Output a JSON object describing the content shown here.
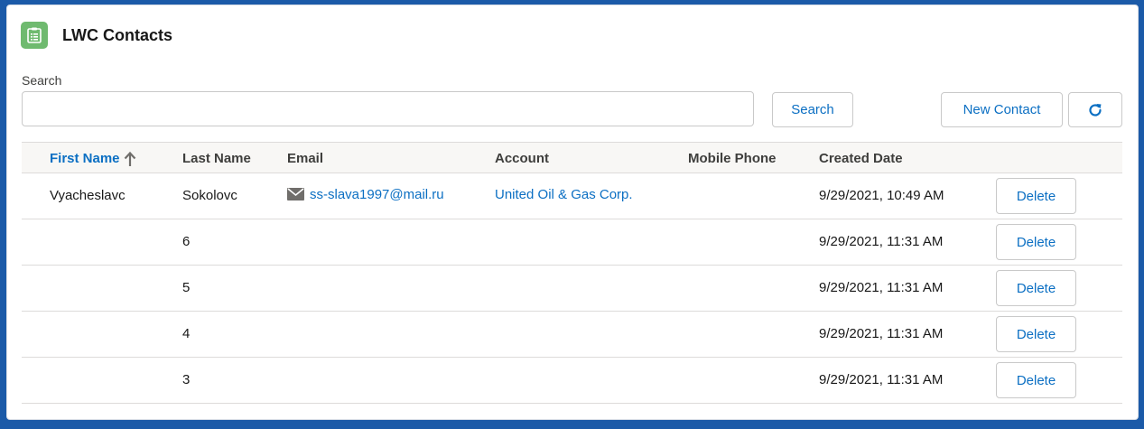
{
  "card": {
    "title": "LWC Contacts",
    "icon": "contacts-list-icon",
    "icon_color": "#6fba6f"
  },
  "search": {
    "label": "Search",
    "value": "",
    "placeholder": "",
    "button_label": "Search"
  },
  "actions": {
    "new_contact_label": "New Contact",
    "refresh_icon": "refresh-icon"
  },
  "table": {
    "columns": [
      "First Name",
      "Last Name",
      "Email",
      "Account",
      "Mobile Phone",
      "Created Date"
    ],
    "sorted_column": "First Name",
    "sort_direction": "ascending",
    "delete_label": "Delete",
    "rows": [
      {
        "first_name": "Vyacheslavc",
        "last_name": "Sokolovc",
        "email": "ss-slava1997@mail.ru",
        "account": "United Oil & Gas Corp.",
        "mobile_phone": "",
        "created_date": "9/29/2021, 10:49 AM"
      },
      {
        "first_name": "",
        "last_name": "6",
        "email": "",
        "account": "",
        "mobile_phone": "",
        "created_date": "9/29/2021, 11:31 AM"
      },
      {
        "first_name": "",
        "last_name": "5",
        "email": "",
        "account": "",
        "mobile_phone": "",
        "created_date": "9/29/2021, 11:31 AM"
      },
      {
        "first_name": "",
        "last_name": "4",
        "email": "",
        "account": "",
        "mobile_phone": "",
        "created_date": "9/29/2021, 11:31 AM"
      },
      {
        "first_name": "",
        "last_name": "3",
        "email": "",
        "account": "",
        "mobile_phone": "",
        "created_date": "9/29/2021, 11:31 AM"
      }
    ]
  },
  "colors": {
    "link": "#0b6fc3",
    "background": "#1b5aa8"
  }
}
